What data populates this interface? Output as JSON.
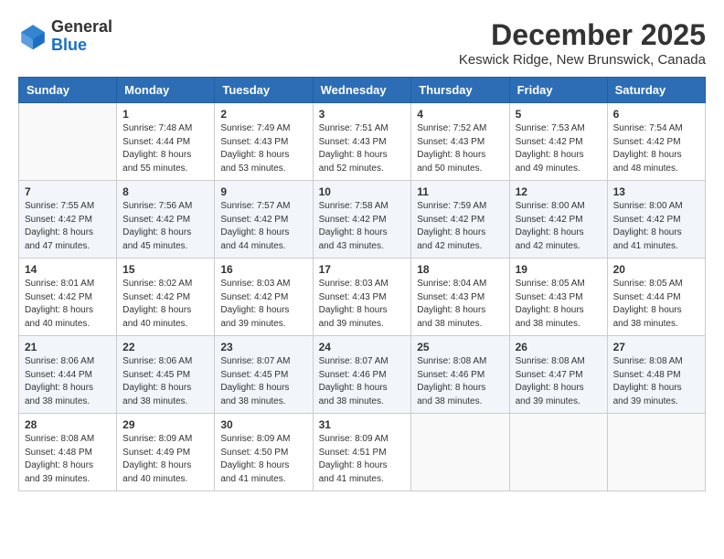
{
  "logo": {
    "general": "General",
    "blue": "Blue"
  },
  "title": "December 2025",
  "subtitle": "Keswick Ridge, New Brunswick, Canada",
  "weekdays": [
    "Sunday",
    "Monday",
    "Tuesday",
    "Wednesday",
    "Thursday",
    "Friday",
    "Saturday"
  ],
  "weeks": [
    [
      {
        "day": "",
        "info": ""
      },
      {
        "day": "1",
        "info": "Sunrise: 7:48 AM\nSunset: 4:44 PM\nDaylight: 8 hours\nand 55 minutes."
      },
      {
        "day": "2",
        "info": "Sunrise: 7:49 AM\nSunset: 4:43 PM\nDaylight: 8 hours\nand 53 minutes."
      },
      {
        "day": "3",
        "info": "Sunrise: 7:51 AM\nSunset: 4:43 PM\nDaylight: 8 hours\nand 52 minutes."
      },
      {
        "day": "4",
        "info": "Sunrise: 7:52 AM\nSunset: 4:43 PM\nDaylight: 8 hours\nand 50 minutes."
      },
      {
        "day": "5",
        "info": "Sunrise: 7:53 AM\nSunset: 4:42 PM\nDaylight: 8 hours\nand 49 minutes."
      },
      {
        "day": "6",
        "info": "Sunrise: 7:54 AM\nSunset: 4:42 PM\nDaylight: 8 hours\nand 48 minutes."
      }
    ],
    [
      {
        "day": "7",
        "info": "Sunrise: 7:55 AM\nSunset: 4:42 PM\nDaylight: 8 hours\nand 47 minutes."
      },
      {
        "day": "8",
        "info": "Sunrise: 7:56 AM\nSunset: 4:42 PM\nDaylight: 8 hours\nand 45 minutes."
      },
      {
        "day": "9",
        "info": "Sunrise: 7:57 AM\nSunset: 4:42 PM\nDaylight: 8 hours\nand 44 minutes."
      },
      {
        "day": "10",
        "info": "Sunrise: 7:58 AM\nSunset: 4:42 PM\nDaylight: 8 hours\nand 43 minutes."
      },
      {
        "day": "11",
        "info": "Sunrise: 7:59 AM\nSunset: 4:42 PM\nDaylight: 8 hours\nand 42 minutes."
      },
      {
        "day": "12",
        "info": "Sunrise: 8:00 AM\nSunset: 4:42 PM\nDaylight: 8 hours\nand 42 minutes."
      },
      {
        "day": "13",
        "info": "Sunrise: 8:00 AM\nSunset: 4:42 PM\nDaylight: 8 hours\nand 41 minutes."
      }
    ],
    [
      {
        "day": "14",
        "info": "Sunrise: 8:01 AM\nSunset: 4:42 PM\nDaylight: 8 hours\nand 40 minutes."
      },
      {
        "day": "15",
        "info": "Sunrise: 8:02 AM\nSunset: 4:42 PM\nDaylight: 8 hours\nand 40 minutes."
      },
      {
        "day": "16",
        "info": "Sunrise: 8:03 AM\nSunset: 4:42 PM\nDaylight: 8 hours\nand 39 minutes."
      },
      {
        "day": "17",
        "info": "Sunrise: 8:03 AM\nSunset: 4:43 PM\nDaylight: 8 hours\nand 39 minutes."
      },
      {
        "day": "18",
        "info": "Sunrise: 8:04 AM\nSunset: 4:43 PM\nDaylight: 8 hours\nand 38 minutes."
      },
      {
        "day": "19",
        "info": "Sunrise: 8:05 AM\nSunset: 4:43 PM\nDaylight: 8 hours\nand 38 minutes."
      },
      {
        "day": "20",
        "info": "Sunrise: 8:05 AM\nSunset: 4:44 PM\nDaylight: 8 hours\nand 38 minutes."
      }
    ],
    [
      {
        "day": "21",
        "info": "Sunrise: 8:06 AM\nSunset: 4:44 PM\nDaylight: 8 hours\nand 38 minutes."
      },
      {
        "day": "22",
        "info": "Sunrise: 8:06 AM\nSunset: 4:45 PM\nDaylight: 8 hours\nand 38 minutes."
      },
      {
        "day": "23",
        "info": "Sunrise: 8:07 AM\nSunset: 4:45 PM\nDaylight: 8 hours\nand 38 minutes."
      },
      {
        "day": "24",
        "info": "Sunrise: 8:07 AM\nSunset: 4:46 PM\nDaylight: 8 hours\nand 38 minutes."
      },
      {
        "day": "25",
        "info": "Sunrise: 8:08 AM\nSunset: 4:46 PM\nDaylight: 8 hours\nand 38 minutes."
      },
      {
        "day": "26",
        "info": "Sunrise: 8:08 AM\nSunset: 4:47 PM\nDaylight: 8 hours\nand 39 minutes."
      },
      {
        "day": "27",
        "info": "Sunrise: 8:08 AM\nSunset: 4:48 PM\nDaylight: 8 hours\nand 39 minutes."
      }
    ],
    [
      {
        "day": "28",
        "info": "Sunrise: 8:08 AM\nSunset: 4:48 PM\nDaylight: 8 hours\nand 39 minutes."
      },
      {
        "day": "29",
        "info": "Sunrise: 8:09 AM\nSunset: 4:49 PM\nDaylight: 8 hours\nand 40 minutes."
      },
      {
        "day": "30",
        "info": "Sunrise: 8:09 AM\nSunset: 4:50 PM\nDaylight: 8 hours\nand 41 minutes."
      },
      {
        "day": "31",
        "info": "Sunrise: 8:09 AM\nSunset: 4:51 PM\nDaylight: 8 hours\nand 41 minutes."
      },
      {
        "day": "",
        "info": ""
      },
      {
        "day": "",
        "info": ""
      },
      {
        "day": "",
        "info": ""
      }
    ]
  ]
}
